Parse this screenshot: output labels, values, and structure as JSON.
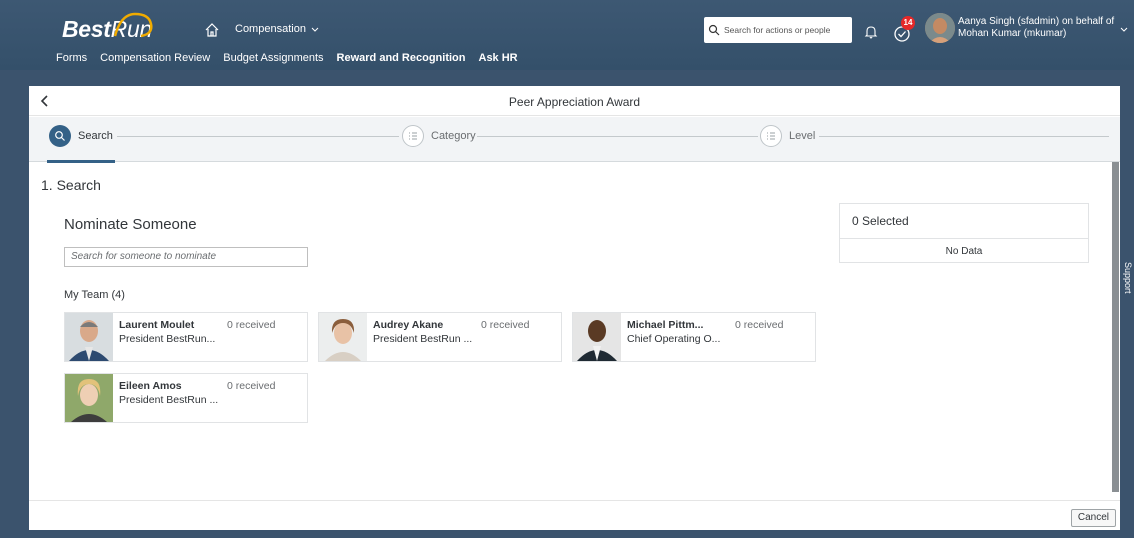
{
  "header": {
    "logo_bold": "Best",
    "logo_light": "Run",
    "module": "Compensation",
    "search_placeholder": "Search for actions or people",
    "todo_badge": "14",
    "user_name": "Aanya Singh (sfadmin) on behalf of Mohan Kumar (mkumar)",
    "nav": [
      "Forms",
      "Compensation Review",
      "Budget Assignments",
      "Reward and Recognition",
      "Ask HR"
    ]
  },
  "page": {
    "title": "Peer Appreciation Award",
    "steps": [
      "Search",
      "Category",
      "Level"
    ],
    "section_title": "1. Search",
    "nominate_title": "Nominate Someone",
    "nominate_placeholder": "Search for someone to nominate",
    "team_title": "My Team (4)"
  },
  "team": [
    {
      "name": "Laurent Moulet",
      "role": "President BestRun...",
      "received": "0 received"
    },
    {
      "name": "Audrey Akane",
      "role": "President BestRun ...",
      "received": "0 received"
    },
    {
      "name": "Michael Pittm...",
      "role": "Chief Operating O...",
      "received": "0 received"
    },
    {
      "name": "Eileen Amos",
      "role": "President BestRun ...",
      "received": "0 received"
    }
  ],
  "selected": {
    "title": "0 Selected",
    "empty": "No Data"
  },
  "footer": {
    "cancel": "Cancel"
  },
  "support": "Support",
  "colors": {
    "shell": "#3b536d",
    "accent": "#346187",
    "badge": "#e52929"
  }
}
